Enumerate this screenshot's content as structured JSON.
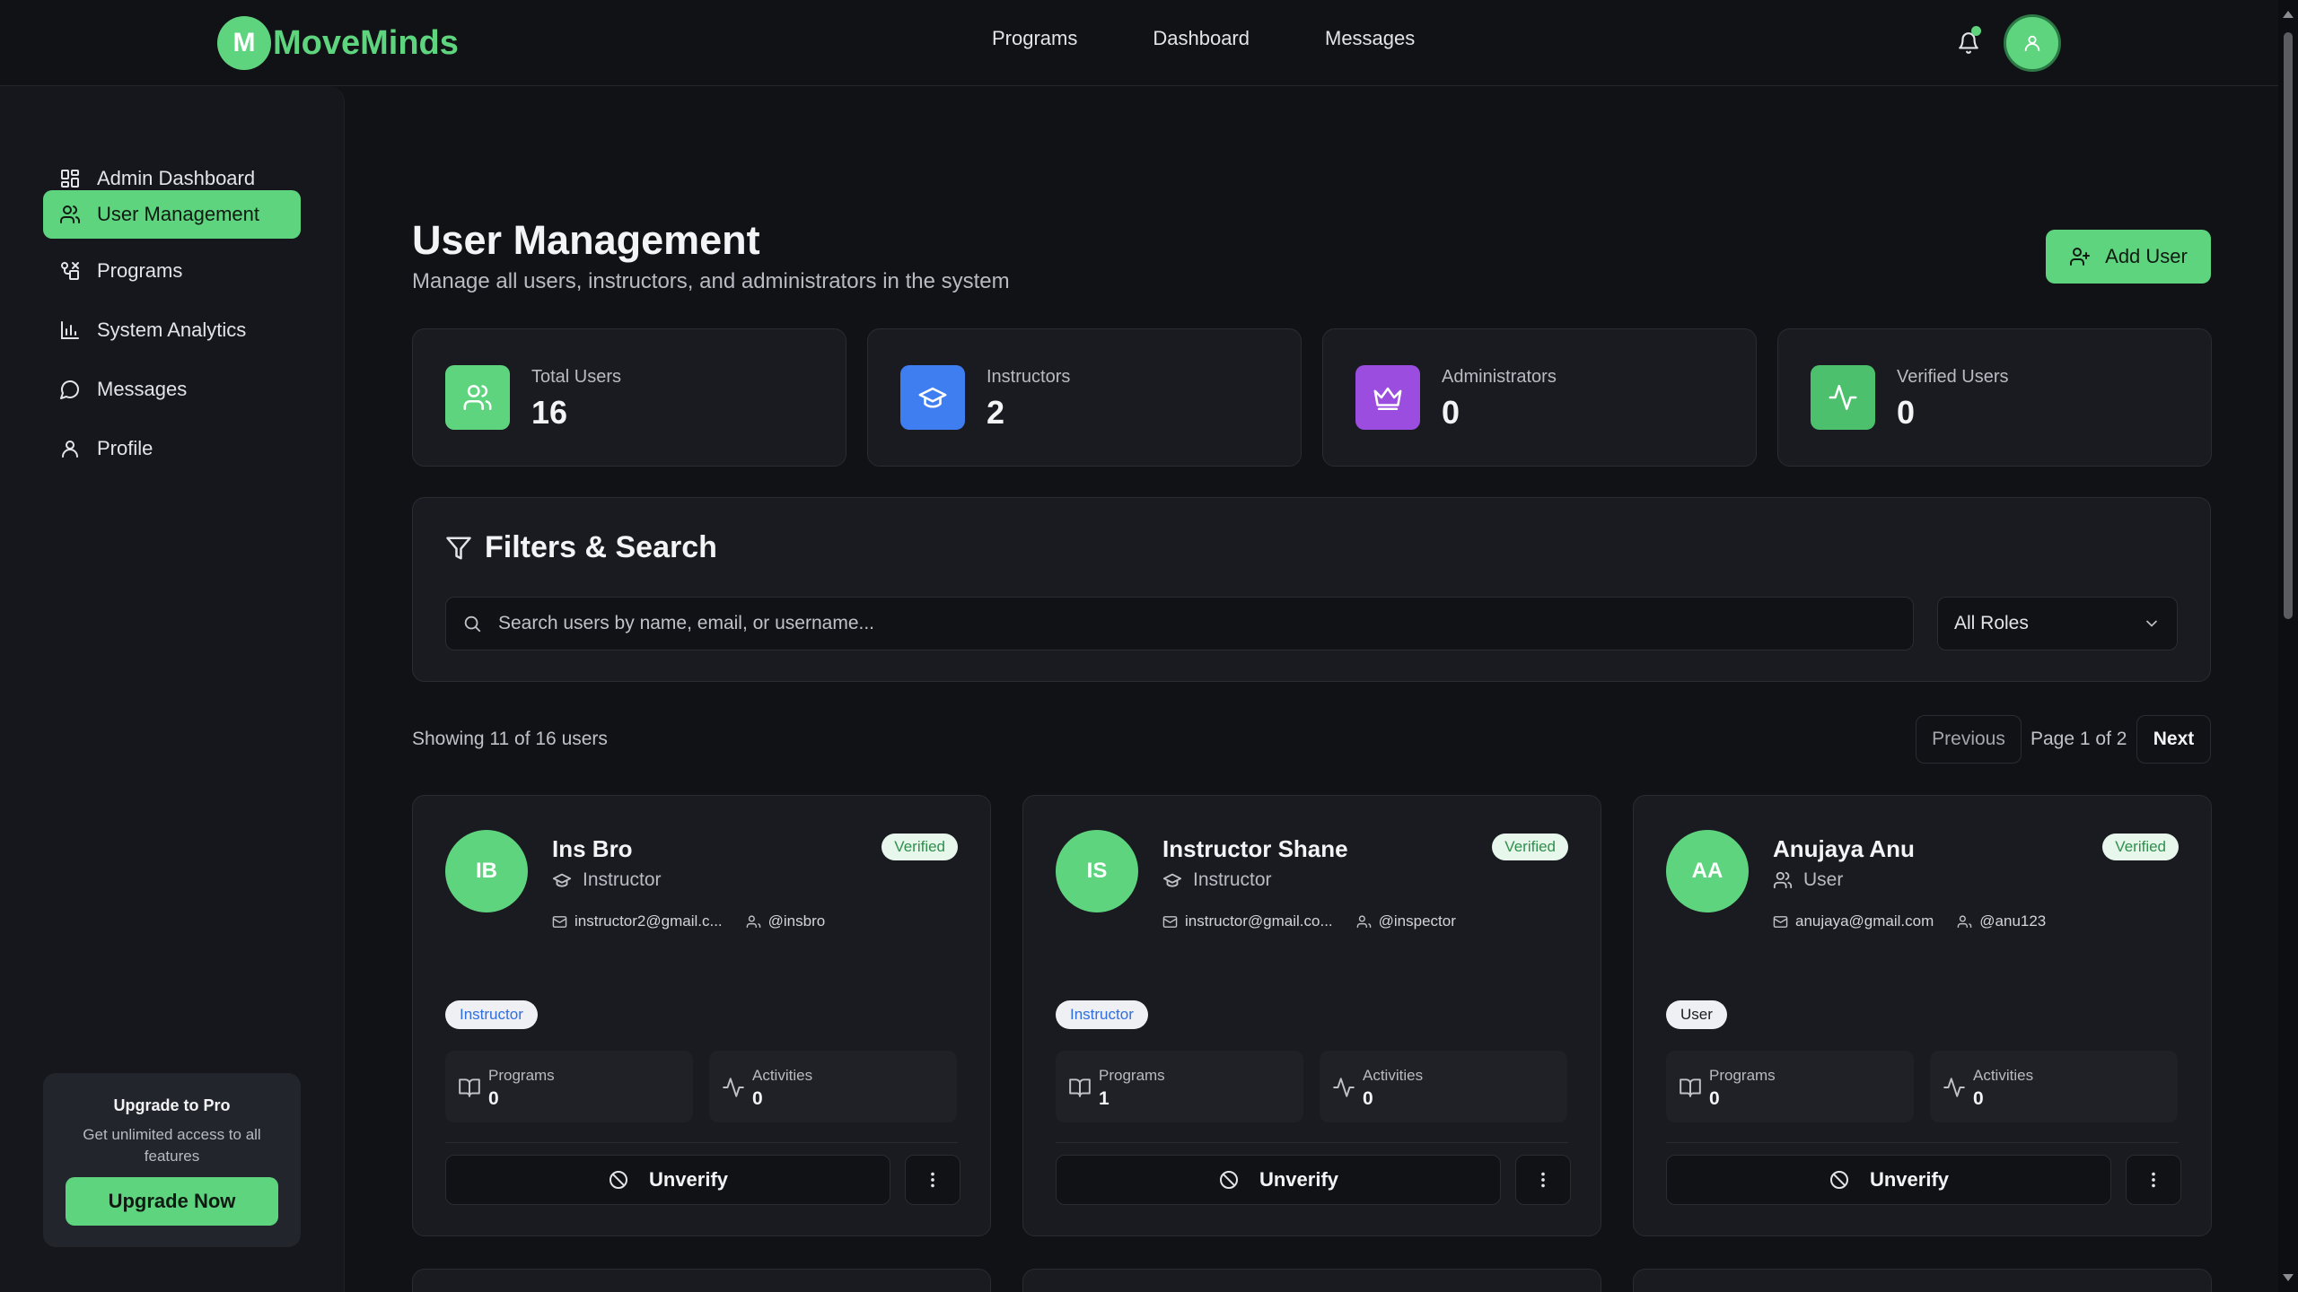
{
  "brand": {
    "badge": "M",
    "name": "MoveMinds",
    "color": "#5fd47f"
  },
  "topnav": {
    "items": [
      "Programs",
      "Dashboard",
      "Messages"
    ]
  },
  "header_icons": [
    "bell-icon",
    "user-icon"
  ],
  "sidebar": {
    "items": [
      {
        "label": "Admin Dashboard",
        "icon": "dashboard-grid-icon",
        "active": false
      },
      {
        "label": "User Management",
        "icon": "users-icon",
        "active": true
      },
      {
        "label": "Programs",
        "icon": "programs-icon",
        "active": false
      },
      {
        "label": "System Analytics",
        "icon": "bar-chart-icon",
        "active": false
      },
      {
        "label": "Messages",
        "icon": "message-icon",
        "active": false
      },
      {
        "label": "Profile",
        "icon": "user-icon",
        "active": false
      }
    ],
    "upgrade": {
      "title": "Upgrade to Pro",
      "desc": "Get unlimited access to all features",
      "button": "Upgrade Now"
    }
  },
  "page": {
    "title": "User Management",
    "subtitle": "Manage all users, instructors, and administrators in the system",
    "add_button": "Add User"
  },
  "stats": [
    {
      "label": "Total Users",
      "value": "16",
      "icon": "users-icon",
      "color": "#5fd47f"
    },
    {
      "label": "Instructors",
      "value": "2",
      "icon": "graduation-cap-icon",
      "color": "#3f7ef0"
    },
    {
      "label": "Administrators",
      "value": "0",
      "icon": "crown-icon",
      "color": "#9b4de0"
    },
    {
      "label": "Verified Users",
      "value": "0",
      "icon": "activity-icon",
      "color": "#4cc06d"
    }
  ],
  "filters": {
    "title": "Filters & Search",
    "search_placeholder": "Search users by name, email, or username...",
    "role_select": "All Roles"
  },
  "pagination": {
    "showing": "Showing 11 of 16 users",
    "previous": "Previous",
    "page": "Page 1 of 2",
    "next": "Next"
  },
  "users": [
    {
      "initials": "IB",
      "name": "Ins Bro",
      "role": "Instructor",
      "role_icon": "graduation-cap-icon",
      "status": "Verified",
      "email": "instructor2@gmail.c...",
      "username": "@insbro",
      "tag": "Instructor",
      "tag_color": "#2f6fe0",
      "programs_label": "Programs",
      "programs": "0",
      "activities_label": "Activities",
      "activities": "0",
      "action": "Unverify"
    },
    {
      "initials": "IS",
      "name": "Instructor Shane",
      "role": "Instructor",
      "role_icon": "graduation-cap-icon",
      "status": "Verified",
      "email": "instructor@gmail.co...",
      "username": "@inspector",
      "tag": "Instructor",
      "tag_color": "#2f6fe0",
      "programs_label": "Programs",
      "programs": "1",
      "activities_label": "Activities",
      "activities": "0",
      "action": "Unverify"
    },
    {
      "initials": "AA",
      "name": "Anujaya Anu",
      "role": "User",
      "role_icon": "users-icon",
      "status": "Verified",
      "email": "anujaya@gmail.com",
      "username": "@anu123",
      "tag": "User",
      "tag_color": "#1b1c20",
      "programs_label": "Programs",
      "programs": "0",
      "activities_label": "Activities",
      "activities": "0",
      "action": "Unverify"
    }
  ]
}
